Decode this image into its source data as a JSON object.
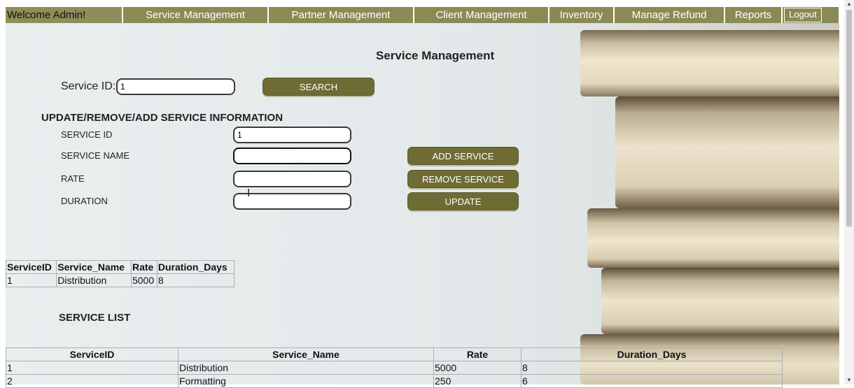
{
  "nav": {
    "welcome": "Welcome Admin!",
    "items": [
      "Service Management",
      "Partner Management",
      "Client Management",
      "Inventory",
      "Manage Refund",
      "Reports"
    ],
    "logout": "Logout"
  },
  "page_title": "Service Management",
  "search": {
    "label": "Service ID:",
    "value": "1",
    "button": "SEARCH"
  },
  "form": {
    "heading": "UPDATE/REMOVE/ADD SERVICE INFORMATION",
    "service_id_label": "SERVICE ID",
    "service_id_value": "1",
    "service_name_label": "SERVICE NAME",
    "service_name_value": "",
    "rate_label": "RATE",
    "rate_value": "",
    "duration_label": "DURATION",
    "duration_value": "",
    "add_button": "ADD SERVICE",
    "remove_button": "REMOVE SERVICE",
    "update_button": "UPDATE"
  },
  "result_table": {
    "headers": [
      "ServiceID",
      "Service_Name",
      "Rate",
      "Duration_Days"
    ],
    "rows": [
      [
        "1",
        "Distribution",
        "5000",
        "8"
      ]
    ]
  },
  "service_list": {
    "heading": "SERVICE LIST",
    "headers": [
      "ServiceID",
      "Service_Name",
      "Rate",
      "Duration_Days"
    ],
    "rows": [
      [
        "1",
        "Distribution",
        "5000",
        "8"
      ],
      [
        "2",
        "Formatting",
        "250",
        "6"
      ]
    ]
  },
  "colors": {
    "nav_bg": "#8b8a55",
    "button_bg": "#6e6c34"
  }
}
